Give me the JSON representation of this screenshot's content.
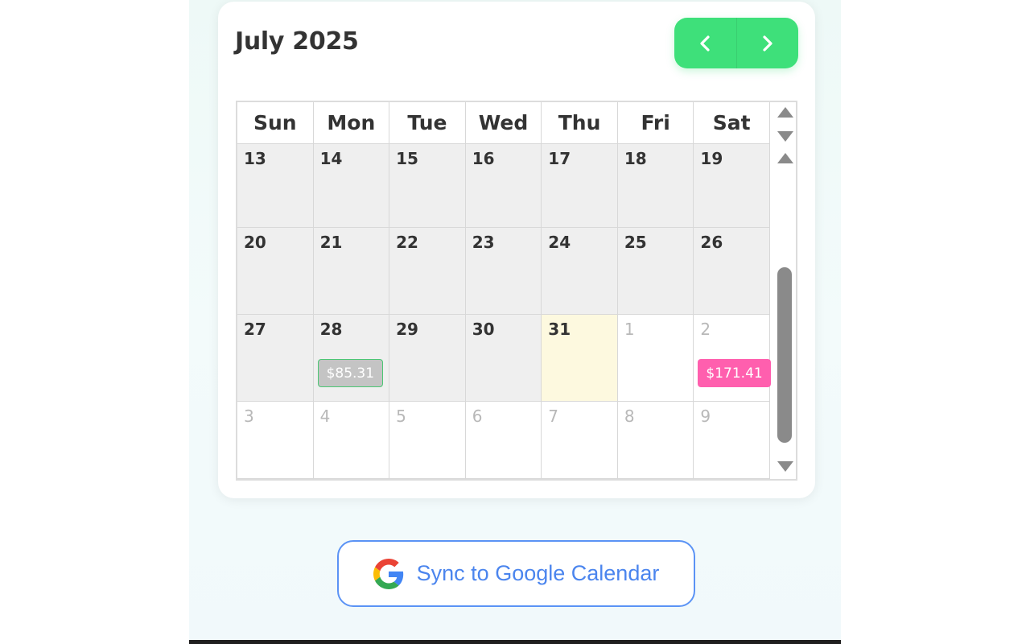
{
  "calendar": {
    "month_title": "July 2025",
    "weekdays": [
      "Sun",
      "Mon",
      "Tue",
      "Wed",
      "Thu",
      "Fri",
      "Sat"
    ],
    "weeks": [
      [
        {
          "day": "13"
        },
        {
          "day": "14"
        },
        {
          "day": "15"
        },
        {
          "day": "16"
        },
        {
          "day": "17"
        },
        {
          "day": "18"
        },
        {
          "day": "19"
        }
      ],
      [
        {
          "day": "20"
        },
        {
          "day": "21"
        },
        {
          "day": "22"
        },
        {
          "day": "23"
        },
        {
          "day": "24"
        },
        {
          "day": "25"
        },
        {
          "day": "26"
        }
      ],
      [
        {
          "day": "27"
        },
        {
          "day": "28",
          "amount": "$85.31",
          "amount_style": "gray"
        },
        {
          "day": "29"
        },
        {
          "day": "30"
        },
        {
          "day": "31",
          "today": true
        },
        {
          "day": "1",
          "other_month": true
        },
        {
          "day": "2",
          "other_month": true,
          "amount": "$171.41",
          "amount_style": "pink"
        }
      ],
      [
        {
          "day": "3",
          "other_month": true
        },
        {
          "day": "4",
          "other_month": true
        },
        {
          "day": "5",
          "other_month": true
        },
        {
          "day": "6",
          "other_month": true
        },
        {
          "day": "7",
          "other_month": true
        },
        {
          "day": "8",
          "other_month": true
        },
        {
          "day": "9",
          "other_month": true
        }
      ]
    ]
  },
  "nav": {
    "prev_icon": "chevron-left-icon",
    "next_icon": "chevron-right-icon"
  },
  "sync": {
    "label": "Sync to Google Calendar",
    "icon": "google-icon"
  },
  "colors": {
    "nav_green": "#3ee07a",
    "past_cell": "#efefef",
    "today_cell": "#fdf9df",
    "pill_gray": "#c4c4c4",
    "pill_pink": "#ff5fae",
    "sync_blue": "#4b85ee"
  }
}
